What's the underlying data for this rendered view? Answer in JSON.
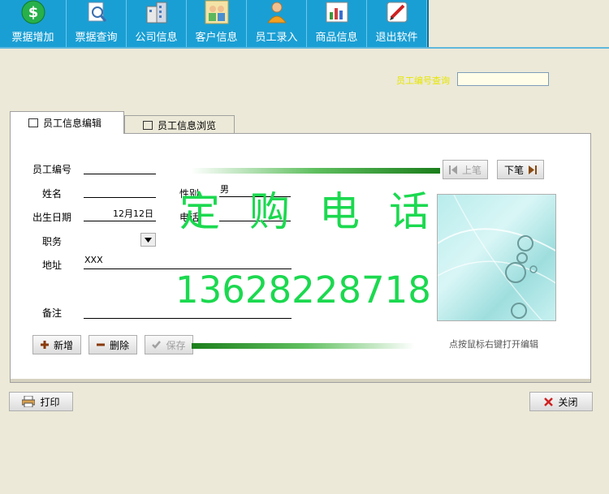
{
  "toolbar": {
    "items": [
      {
        "label": "票据增加",
        "icon": "dollar-icon"
      },
      {
        "label": "票据查询",
        "icon": "search-document-icon"
      },
      {
        "label": "公司信息",
        "icon": "building-icon"
      },
      {
        "label": "客户信息",
        "icon": "customers-icon"
      },
      {
        "label": "员工录入",
        "icon": "employee-icon"
      },
      {
        "label": "商品信息",
        "icon": "chart-icon"
      },
      {
        "label": "退出软件",
        "icon": "exit-icon"
      }
    ]
  },
  "search": {
    "label": "员工编号查询",
    "value": ""
  },
  "tabs": {
    "edit": "员工信息编辑",
    "browse": "员工信息浏览"
  },
  "form": {
    "id_label": "员工编号",
    "id_value": "",
    "name_label": "姓名",
    "name_value": "",
    "gender_label": "性别",
    "gender_value": "男",
    "birth_label": "出生日期",
    "birth_value": "12月12日",
    "phone_label": "电话",
    "phone_value": "",
    "position_label": "职务",
    "position_value": "",
    "address_label": "地址",
    "address_value": "XXX",
    "remark_label": "备注",
    "remark_value": ""
  },
  "nav": {
    "prev": "上笔",
    "next": "下笔"
  },
  "actions": {
    "add": "新增",
    "delete": "删除",
    "save": "保存"
  },
  "photo_hint": "点按鼠标右键打开编辑",
  "footer": {
    "print": "打印",
    "close": "关闭"
  },
  "watermark": {
    "title": "定购电话",
    "phone": "13628228718"
  },
  "colors": {
    "toolbar": "#1a9fd4",
    "watermark": "#1bd94f",
    "accent_line": "#1b7e1b"
  }
}
